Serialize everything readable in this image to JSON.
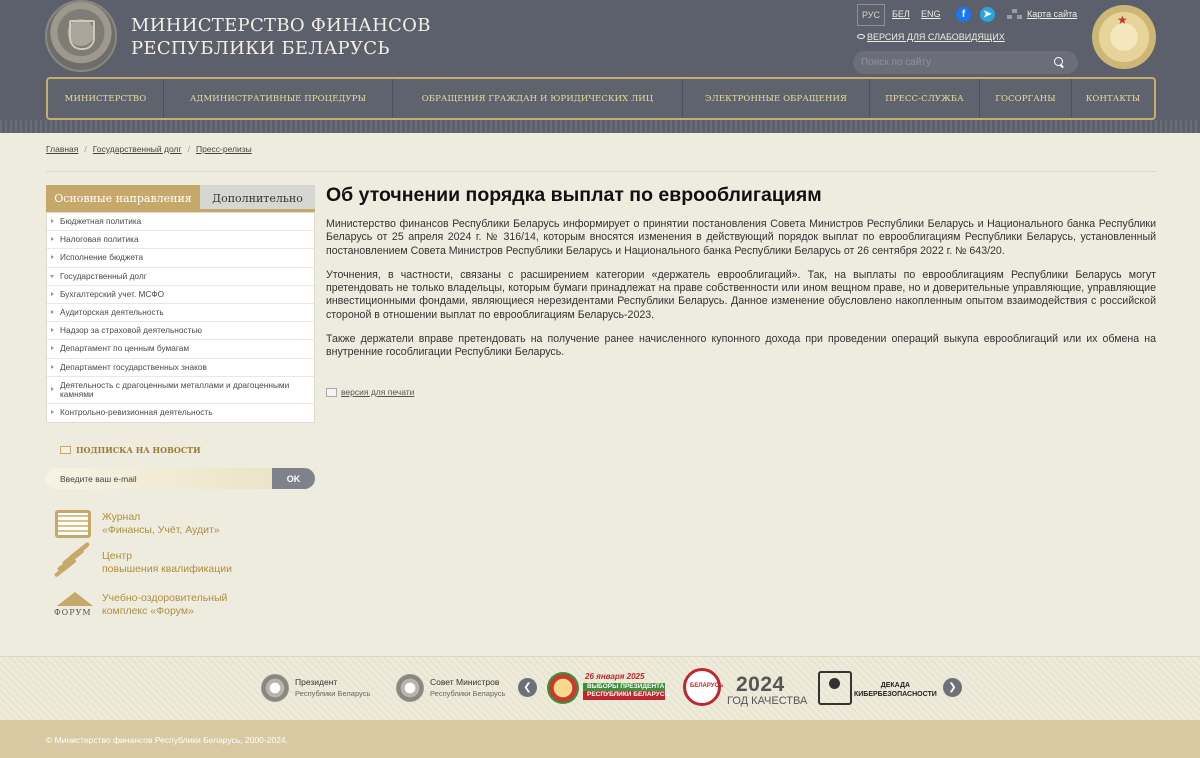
{
  "header": {
    "title_line1": "МИНИСТЕРСТВО ФИНАНСОВ",
    "title_line2": "РЕСПУБЛИКИ БЕЛАРУСЬ",
    "languages": [
      "РУС",
      "БЕЛ",
      "ENG"
    ],
    "active_language": "РУС",
    "sitemap_label": "Карта сайта",
    "low_vision_label": "ВЕРСИЯ ДЛЯ СЛАБОВИДЯЩИХ",
    "search_placeholder": "Поиск по сайту"
  },
  "nav": {
    "items": [
      "МИНИСТЕРСТВО",
      "АДМИНИСТРАТИВНЫЕ ПРОЦЕДУРЫ",
      "ОБРАЩЕНИЯ ГРАЖДАН И ЮРИДИЧЕСКИХ ЛИЦ",
      "ЭЛЕКТРОННЫЕ ОБРАЩЕНИЯ",
      "ПРЕСС-СЛУЖБА",
      "ГОСОРГАНЫ",
      "КОНТАКТЫ"
    ]
  },
  "breadcrumb": [
    "Главная",
    "Государственный долг",
    "Пресс-релизы"
  ],
  "sidebar": {
    "tab_main": "Основные направления",
    "tab_extra": "Дополнительно",
    "items": [
      "Бюджетная политика",
      "Налоговая политика",
      "Исполнение бюджета",
      "Государственный долг",
      "Бухгалтерский учет. МСФО",
      "Аудиторская деятельность",
      "Надзор за страховой деятельностью",
      "Департамент по ценным бумагам",
      "Департамент государственных знаков",
      "Деятельность с драгоценными металлами и драгоценными камнями",
      "Контрольно-ревизионная деятельность"
    ],
    "newsletter_title": "ПОДПИСКА НА НОВОСТИ",
    "email_placeholder": "Введите ваш e-mail",
    "ok_label": "OK",
    "promos": [
      {
        "line1": "Журнал",
        "line2": "«Финансы, Учёт, Аудит»"
      },
      {
        "line1": "Центр",
        "line2": "повышения квалификации"
      },
      {
        "line1": "Учебно-оздоровительный",
        "line2": "комплекс «Форум»"
      }
    ],
    "forum_logo_text": "ФОРУМ"
  },
  "article": {
    "title": "Об уточнении порядка выплат по еврооблигациям",
    "paragraphs": [
      "Министерство финансов Республики Беларусь информирует о принятии постановления Совета Министров Республики Беларусь и Национального банка Республики Беларусь от 25 апреля 2024 г. № 316/14, которым вносятся изменения в действующий порядок выплат по еврооблигациям Республики Беларусь, установленный постановлением Совета Министров Республики Беларусь и Национального банка Республики Беларусь от 26 сентября 2022 г. № 643/20.",
      "Уточнения, в частности, связаны с расширением категории «держатель еврооблигаций». Так, на выплаты по еврооблигациям Республики Беларусь могут претендовать не только владельцы, которым бумаги принадлежат на праве собственности или ином вещном праве, но и доверительные управляющие, управляющие инвестиционными фондами, являющиеся нерезидентами Республики Беларусь. Данное изменение обусловлено накопленным опытом взаимодействия с российской стороной в отношении выплат по еврооблигациям Беларусь-2023.",
      "Также держатели вправе претендовать на получение ранее начисленного купонного дохода при проведении операций выкупа еврооблигаций или их обмена на внутренние гособлигации Республики Беларусь."
    ],
    "print_label": "версия для печати"
  },
  "banners": {
    "president_title": "Президент",
    "president_sub": "Республики Беларусь",
    "council_title": "Совет Министров",
    "council_sub": "Республики Беларусь",
    "election_date": "26 января 2025",
    "election_line1": "ВЫБОРЫ ПРЕЗИДЕНТА",
    "election_line2": "РЕСПУБЛИКИ БЕЛАРУСЬ",
    "quality_badge": "БЕЛАРУСЬ",
    "quality_year": "2024",
    "quality_text": "ГОД КАЧЕСТВА",
    "cyber_line1": "ДЕКАДА",
    "cyber_line2": "КИБЕРБЕЗОПАСНОСТИ"
  },
  "footer": {
    "copyright": "© Министерство финансов Республики Беларусь, 2000-2024."
  }
}
